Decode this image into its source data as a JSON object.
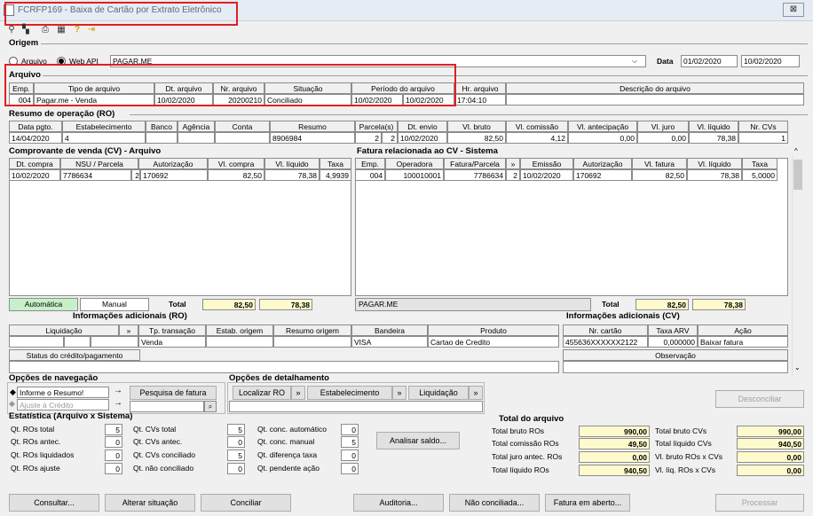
{
  "window": {
    "title": "FCRFP169 - Baixa de Cartão por Extrato Eletrônico",
    "close": "⊠"
  },
  "toolbar": {
    "icons": [
      "pin-icon",
      "layout-icon",
      "print-icon",
      "grid-icon",
      "help-icon",
      "exit-icon"
    ]
  },
  "origem": {
    "label": "Origem",
    "radio1": "Arquivo",
    "radio2": "Web API",
    "source": "PAGAR.ME",
    "data_label": "Data",
    "date_from": "01/02/2020",
    "date_to": "10/02/2020"
  },
  "arquivo": {
    "label": "Arquivo",
    "headers": [
      "Emp.",
      "Tipo de arquivo",
      "Dt. arquivo",
      "Nr. arquivo",
      "Situação",
      "Período do arquivo",
      "Hr. arquivo",
      "Descrição do arquivo"
    ],
    "row": {
      "emp": "004",
      "tipo": "Pagar.me - Venda",
      "dt": "10/02/2020",
      "nr": "20200210",
      "sit": "Conciliado",
      "p1": "10/02/2020",
      "p2": "10/02/2020",
      "hr": "17:04:10",
      "desc": ""
    }
  },
  "resumo": {
    "label": "Resumo de operação (RO)",
    "headers": [
      "Data pgto.",
      "Estabelecimento",
      "Banco",
      "Agência",
      "Conta",
      "Resumo",
      "Parcela(s)",
      "Dt. envio",
      "Vl. bruto",
      "Vl. comissão",
      "Vl. antecipação",
      "Vl. juro",
      "Vl. líquido",
      "Nr. CVs"
    ],
    "row": {
      "data": "14/04/2020",
      "estab": "4",
      "banco": "",
      "agencia": "",
      "conta": "",
      "resumo": "8906984",
      "parc_a": "2",
      "parc_b": "2",
      "envio": "10/02/2020",
      "bruto": "82,50",
      "comissao": "4,12",
      "antec": "0,00",
      "juro": "0,00",
      "liquido": "78,38",
      "ncv": "1"
    }
  },
  "cv": {
    "label": "Comprovante de venda (CV) - Arquivo",
    "headers": [
      "Dt. compra",
      "NSU / Parcela",
      "Autorização",
      "Vl. compra",
      "Vl. líquido",
      "Taxa"
    ],
    "row": {
      "dt": "10/02/2020",
      "nsu": "7786634",
      "parc": "2",
      "aut": "170692",
      "compra": "82,50",
      "liq": "78,38",
      "taxa": "4,9939"
    },
    "btn_auto": "Automática",
    "btn_manual": "Manual",
    "total_label": "Total",
    "total1": "82,50",
    "total2": "78,38"
  },
  "fatura": {
    "label": "Fatura relacionada ao CV - Sistema",
    "headers": [
      "Emp.",
      "Operadora",
      "Fatura/Parcela",
      "»",
      "Emissão",
      "Autorização",
      "Vl. fatura",
      "Vl. líquido",
      "Taxa"
    ],
    "row": {
      "emp": "004",
      "oper": "100010001",
      "fat": "7786634",
      "parc": "2",
      "emis": "10/02/2020",
      "aut": "170692",
      "vfat": "82,50",
      "vliq": "78,38",
      "taxa": "5,0000"
    },
    "footer_name": "PAGAR.ME",
    "total_label": "Total",
    "total1": "82,50",
    "total2": "78,38"
  },
  "info_ro": {
    "label": "Informações adicionais (RO)",
    "headers": [
      "Liquidação",
      "»",
      "Tp. transação",
      "Estab. origem",
      "Resumo origem",
      "Bandeira",
      "Produto"
    ],
    "row": {
      "tp": "Venda",
      "band": "VISA",
      "prod": "Cartao de Credito"
    },
    "status": "Status do crédito/pagamento"
  },
  "info_cv": {
    "label": "Informações adicionais (CV)",
    "headers": [
      "Nr. cartão",
      "Taxa ARV",
      "Ação"
    ],
    "row": {
      "cartao": "455636XXXXXX2122",
      "arv": "0,000000",
      "acao": "Baixar fatura"
    },
    "obs": "Observação"
  },
  "nav": {
    "label": "Opções de navegação",
    "opt1": "Informe o Resumo!",
    "opt2": "Ajuste à Crédito",
    "search_btn": "Pesquisa de fatura"
  },
  "detail": {
    "label": "Opções de detalhamento",
    "b1": "Localizar RO",
    "b2": "Estabelecimento",
    "b3": "Liquidação",
    "arrow": "»"
  },
  "desconciliar": "Desconciliar",
  "stats": {
    "label": "Estatística (Arquivo x Sistema)",
    "c1": [
      [
        "Qt. ROs total",
        "5"
      ],
      [
        "Qt. ROs antec.",
        "0"
      ],
      [
        "Qt. ROs liquidados",
        "0"
      ],
      [
        "Qt. ROs ajuste",
        "0"
      ]
    ],
    "c2": [
      [
        "Qt. CVs total",
        "5"
      ],
      [
        "Qt. CVs antec.",
        "0"
      ],
      [
        "Qt. CVs conciliado",
        "5"
      ],
      [
        "Qt. não conciliado",
        "0"
      ]
    ],
    "c3": [
      [
        "Qt. conc. automático",
        "0"
      ],
      [
        "Qt. conc. manual",
        "5"
      ],
      [
        "Qt. diferença taxa",
        "0"
      ],
      [
        "Qt. pendente ação",
        "0"
      ]
    ],
    "analisar": "Analisar saldo..."
  },
  "total_arq": {
    "label": "Total do arquivo",
    "c1": [
      [
        "Total bruto ROs",
        "990,00"
      ],
      [
        "Total comissão ROs",
        "49,50"
      ],
      [
        "Total juro antec. ROs",
        "0,00"
      ],
      [
        "Total líquido ROs",
        "940,50"
      ]
    ],
    "c2": [
      [
        "Total bruto CVs",
        "990,00"
      ],
      [
        "Total líquido CVs",
        "940,50"
      ],
      [
        "Vl. bruto ROs x CVs",
        "0,00"
      ],
      [
        "Vl. líq. ROs x CVs",
        "0,00"
      ]
    ]
  },
  "footer": {
    "consultar": "Consultar...",
    "alterar": "Alterar situação",
    "conciliar": "Conciliar",
    "auditoria": "Auditoria...",
    "nao_conc": "Não conciliada...",
    "fatura_aberto": "Fatura em aberto...",
    "processar": "Processar"
  }
}
